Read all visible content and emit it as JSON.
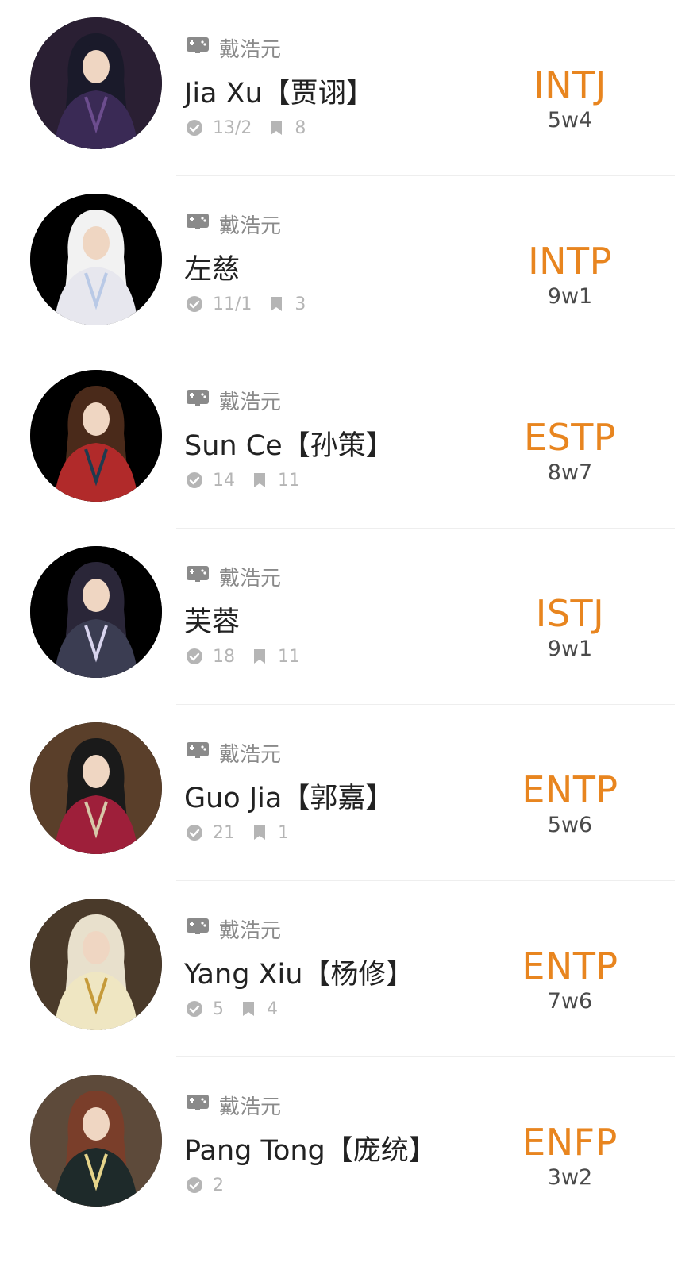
{
  "profiles": [
    {
      "source": "戴浩元",
      "name": "Jia Xu【贾诩】",
      "votes": "13/2",
      "comments": "8",
      "mbti": "INTJ",
      "enneagram": "5w4",
      "colors": {
        "bg": "#2a1f33",
        "robe": "#3a2a55",
        "hair": "#1a1a2a",
        "accent": "#6c4d8e"
      }
    },
    {
      "source": "戴浩元",
      "name": "左慈",
      "votes": "11/1",
      "comments": "3",
      "mbti": "INTP",
      "enneagram": "9w1",
      "colors": {
        "bg": "#000000",
        "robe": "#e7e7ee",
        "hair": "#f2f2f2",
        "accent": "#b9c9e6"
      }
    },
    {
      "source": "戴浩元",
      "name": "Sun Ce【孙策】",
      "votes": "14",
      "comments": "11",
      "mbti": "ESTP",
      "enneagram": "8w7",
      "colors": {
        "bg": "#000000",
        "robe": "#b12a2a",
        "hair": "#4a2a1a",
        "accent": "#1e3b4f"
      }
    },
    {
      "source": "戴浩元",
      "name": "芙蓉",
      "votes": "18",
      "comments": "11",
      "mbti": "ISTJ",
      "enneagram": "9w1",
      "colors": {
        "bg": "#000000",
        "robe": "#3b3d52",
        "hair": "#2a2638",
        "accent": "#d8d4ee"
      }
    },
    {
      "source": "戴浩元",
      "name": "Guo Jia【郭嘉】",
      "votes": "21",
      "comments": "1",
      "mbti": "ENTP",
      "enneagram": "5w6",
      "colors": {
        "bg": "#5a3f2a",
        "robe": "#9e1f3a",
        "hair": "#1a1a1a",
        "accent": "#d7c7a8"
      }
    },
    {
      "source": "戴浩元",
      "name": "Yang Xiu【杨修】",
      "votes": "5",
      "comments": "4",
      "mbti": "ENTP",
      "enneagram": "7w6",
      "colors": {
        "bg": "#4a3a2a",
        "robe": "#efe6c2",
        "hair": "#e8e0cc",
        "accent": "#c59a3a"
      }
    },
    {
      "source": "戴浩元",
      "name": "Pang Tong【庞统】",
      "votes": "2",
      "comments": "",
      "mbti": "ENFP",
      "enneagram": "3w2",
      "colors": {
        "bg": "#5d4a3a",
        "robe": "#1e2a2a",
        "hair": "#7a3e2a",
        "accent": "#e6d48a"
      }
    }
  ],
  "icons": {
    "source": "gamepad-icon",
    "votes": "check-circle-icon",
    "comments": "bookmark-icon"
  }
}
